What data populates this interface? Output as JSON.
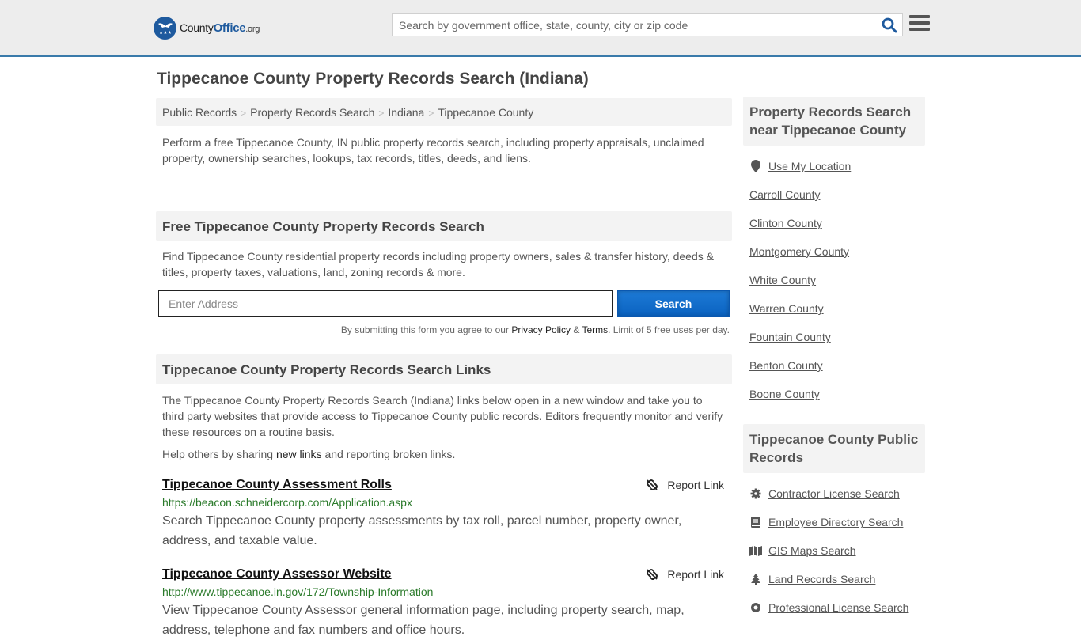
{
  "header": {
    "logo": {
      "name_part1": "County",
      "name_part2": "Office",
      "tld": ".org"
    },
    "search_placeholder": "Search by government office, state, county, city or zip code"
  },
  "page_title": "Tippecanoe County Property Records Search (Indiana)",
  "breadcrumb": [
    "Public Records",
    "Property Records Search",
    "Indiana",
    "Tippecanoe County"
  ],
  "intro": "Perform a free Tippecanoe County, IN public property records search, including property appraisals, unclaimed property, ownership searches, lookups, tax records, titles, deeds, and liens.",
  "free_search": {
    "heading": "Free Tippecanoe County Property Records Search",
    "text": "Find Tippecanoe County residential property records including property owners, sales & transfer history, deeds & titles, property taxes, valuations, land, zoning records & more.",
    "address_placeholder": "Enter Address",
    "button_label": "Search",
    "terms_prefix": "By submitting this form you agree to our ",
    "privacy_label": "Privacy Policy",
    "amp": " & ",
    "terms_label": "Terms",
    "terms_suffix": ". Limit of 5 free uses per day."
  },
  "links_section": {
    "heading": "Tippecanoe County Property Records Search Links",
    "text": "The Tippecanoe County Property Records Search (Indiana) links below open in a new window and take you to third party websites that provide access to Tippecanoe County public records. Editors frequently monitor and verify these resources on a routine basis.",
    "help_prefix": "Help others by sharing ",
    "help_link": "new links",
    "help_suffix": " and reporting broken links.",
    "report_label": "Report Link",
    "items": [
      {
        "title": "Tippecanoe County Assessment Rolls",
        "url": "https://beacon.schneidercorp.com/Application.aspx",
        "description": "Search Tippecanoe County property assessments by tax roll, parcel number, property owner, address, and taxable value."
      },
      {
        "title": "Tippecanoe County Assessor Website",
        "url": "http://www.tippecanoe.in.gov/172/Township-Information",
        "description": "View Tippecanoe County Assessor general information page, including property search, map, address, telephone and fax numbers and office hours."
      }
    ]
  },
  "sidebar": {
    "nearby_heading": "Property Records Search near Tippecanoe County",
    "use_location": "Use My Location",
    "nearby": [
      "Carroll County",
      "Clinton County",
      "Montgomery County",
      "White County",
      "Warren County",
      "Fountain County",
      "Benton County",
      "Boone County"
    ],
    "public_heading": "Tippecanoe County Public Records",
    "public_records": [
      {
        "label": "Contractor License Search",
        "icon": "gear-icon"
      },
      {
        "label": "Employee Directory Search",
        "icon": "book-icon"
      },
      {
        "label": "GIS Maps Search",
        "icon": "map-icon"
      },
      {
        "label": "Land Records Search",
        "icon": "tree-icon"
      },
      {
        "label": "Professional License Search",
        "icon": "badge-icon"
      }
    ]
  },
  "colors": {
    "brand_blue": "#1e5a9e",
    "header_border": "#3a7aaa",
    "button_blue": "#0a62c0",
    "url_green": "#2a7a2a"
  }
}
